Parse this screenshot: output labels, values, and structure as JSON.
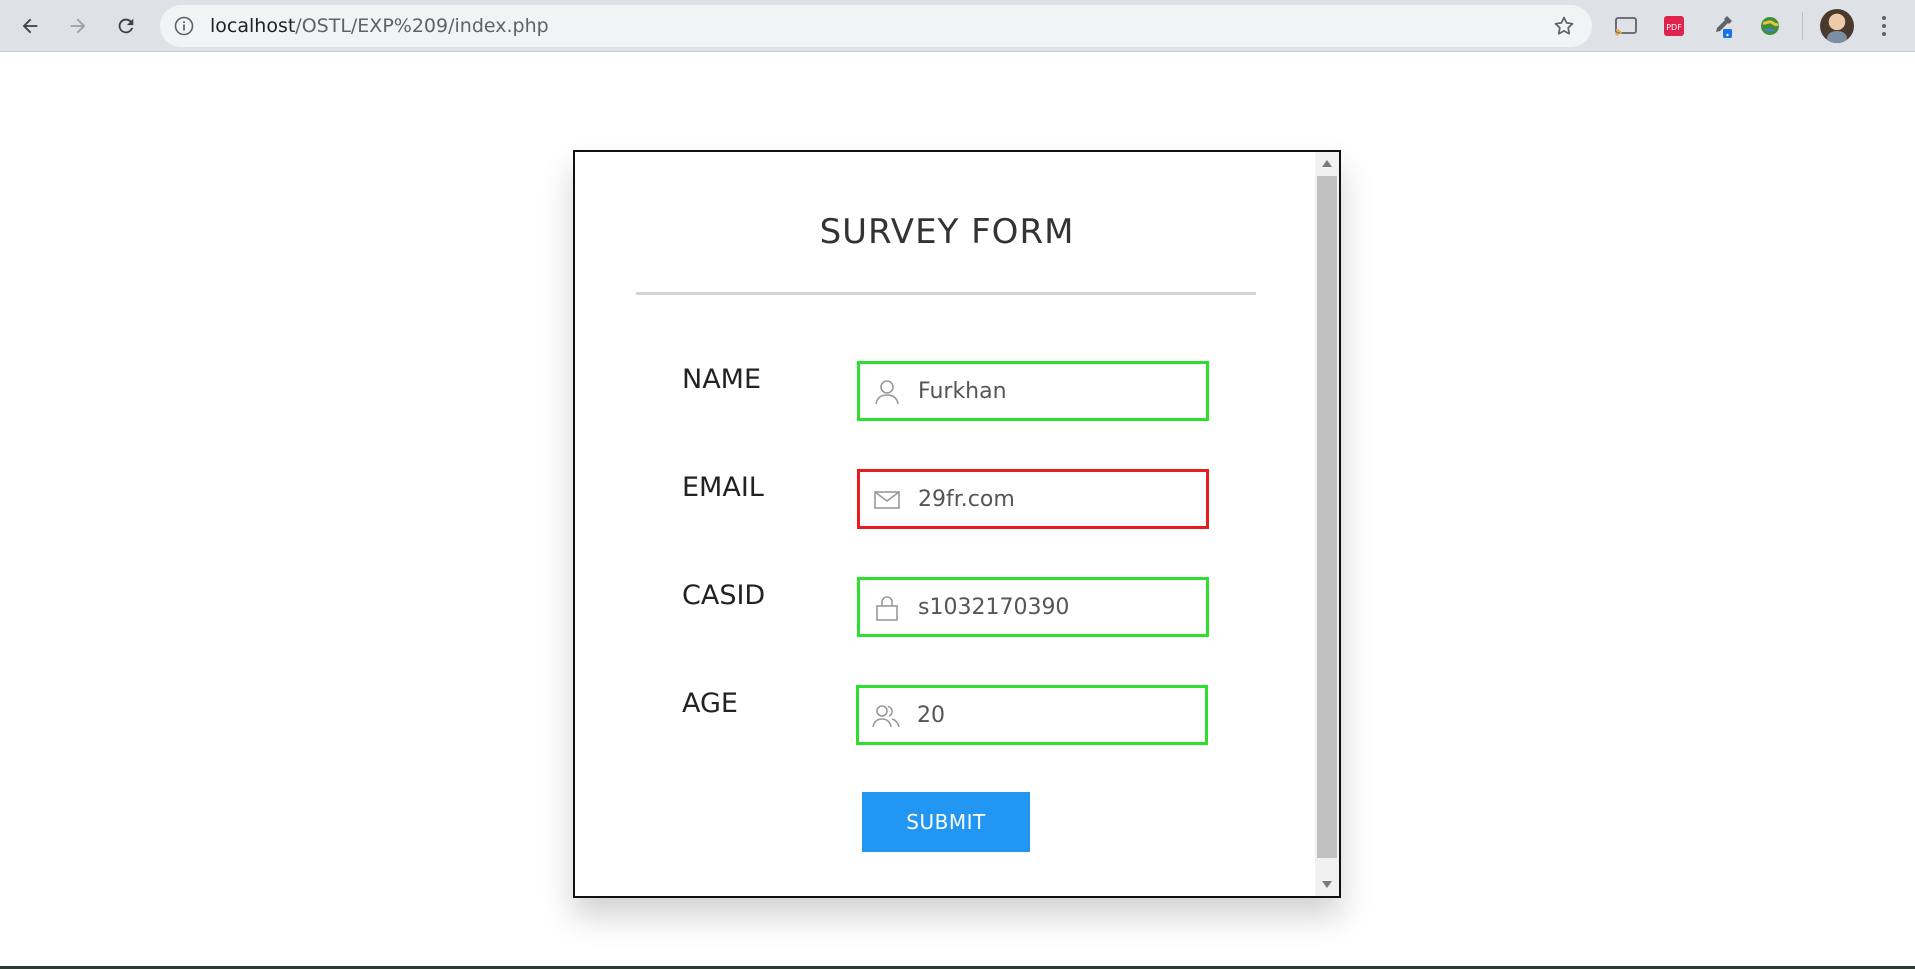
{
  "browser": {
    "url_host": "localhost",
    "url_path": "/OSTL/EXP%209/index.php",
    "extensions": [
      "cast-icon",
      "pdf-icon",
      "eyedropper-icon",
      "globe-icon"
    ]
  },
  "form": {
    "title": "SURVEY FORM",
    "fields": [
      {
        "label": "NAME",
        "value": "Furkhan",
        "icon": "user-icon",
        "valid": true
      },
      {
        "label": "EMAIL",
        "value": "29fr.com",
        "icon": "mail-icon",
        "valid": false
      },
      {
        "label": "CASID",
        "value": "s1032170390",
        "icon": "lock-icon",
        "valid": true
      },
      {
        "label": "AGE",
        "value": "20",
        "icon": "users-icon",
        "valid": true
      }
    ],
    "submit_label": "SUBMIT"
  },
  "colors": {
    "valid_border": "#2de02d",
    "invalid_border": "#e81c1c",
    "button": "#2196f3"
  }
}
